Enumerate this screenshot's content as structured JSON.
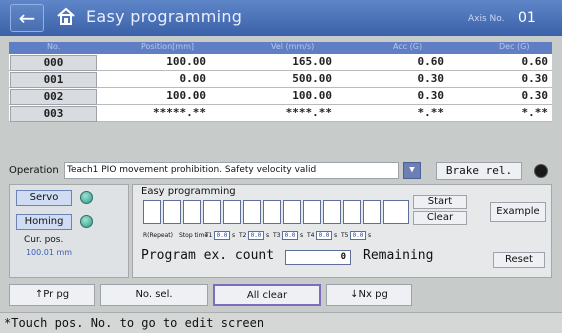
{
  "header": {
    "title": "Easy programming",
    "axis_label": "Axis No.",
    "axis_no": "01",
    "back_icon": "back-arrow-icon",
    "home_icon": "home-icon"
  },
  "table": {
    "columns": [
      "No.",
      "Position[mm]",
      "Vel (mm/s)",
      "Acc (G)",
      "Dec (G)"
    ],
    "rows": [
      {
        "no": "000",
        "position": "100.00",
        "vel": "165.00",
        "acc": "0.60",
        "dec": "0.60"
      },
      {
        "no": "001",
        "position": "0.00",
        "vel": "500.00",
        "acc": "0.30",
        "dec": "0.30"
      },
      {
        "no": "002",
        "position": "100.00",
        "vel": "100.00",
        "acc": "0.30",
        "dec": "0.30"
      },
      {
        "no": "003",
        "position": "*****.**",
        "vel": "****.**",
        "acc": "*.**",
        "dec": "*.**"
      }
    ]
  },
  "operation": {
    "label": "Operation",
    "value": "Teach1 PIO movement prohibition. Safety velocity valid",
    "brake_label": "Brake rel."
  },
  "left_panel": {
    "servo": "Servo",
    "homing": "Homing",
    "cur_pos_label": "Cur. pos.",
    "cur_pos_value": "100.01 mm"
  },
  "easy": {
    "title": "Easy programming",
    "start": "Start",
    "clear": "Clear",
    "example": "Example",
    "repeat_label": "R(Repeat)",
    "stop_time_label": "Stop time",
    "stop_times": [
      {
        "label": "T1",
        "value": "0.0"
      },
      {
        "label": "T2",
        "value": "0.0"
      },
      {
        "label": "T3",
        "value": "0.0"
      },
      {
        "label": "T4",
        "value": "0.0"
      },
      {
        "label": "T5",
        "value": "0.0"
      }
    ],
    "unit": "s",
    "program_count_label": "Program ex. count",
    "program_count_value": "0",
    "remaining_label": "Remaining",
    "reset": "Reset"
  },
  "nav": {
    "prev_page": "↑Pr pg",
    "no_sel": "No. sel.",
    "all_clear": "All clear",
    "next_page": "↓Nx pg"
  },
  "footer": {
    "text": "*Touch pos. No. to go to edit screen"
  }
}
